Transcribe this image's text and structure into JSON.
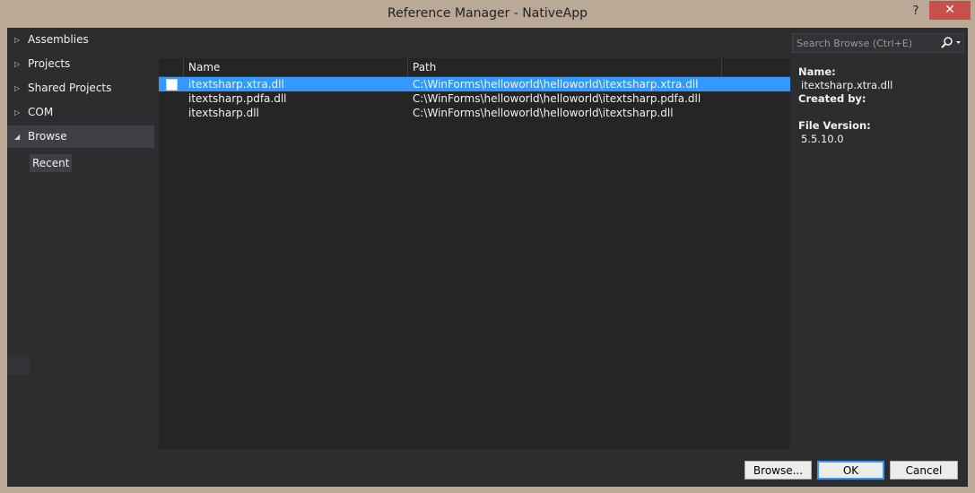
{
  "window": {
    "title": "Reference Manager - NativeApp",
    "help_glyph": "?",
    "close_glyph": "✕"
  },
  "nav": {
    "items": [
      {
        "label": "Assemblies",
        "expanded": false
      },
      {
        "label": "Projects",
        "expanded": false
      },
      {
        "label": "Shared Projects",
        "expanded": false
      },
      {
        "label": "COM",
        "expanded": false
      },
      {
        "label": "Browse",
        "expanded": true
      }
    ],
    "sub_item": "Recent"
  },
  "search": {
    "placeholder": "Search Browse (Ctrl+E)"
  },
  "list": {
    "columns": [
      "Name",
      "Path"
    ],
    "rows": [
      {
        "name": "itextsharp.xtra.dll",
        "path": "C:\\WinForms\\helloworld\\helloworld\\itextsharp.xtra.dll",
        "selected": true,
        "checked": false
      },
      {
        "name": "itextsharp.pdfa.dll",
        "path": "C:\\WinForms\\helloworld\\helloworld\\itextsharp.pdfa.dll",
        "selected": false,
        "checked": false
      },
      {
        "name": "itextsharp.dll",
        "path": "C:\\WinForms\\helloworld\\helloworld\\itextsharp.dll",
        "selected": false,
        "checked": false
      }
    ]
  },
  "details": {
    "name_label": "Name:",
    "name_value": "itextsharp.xtra.dll",
    "created_by_label": "Created by:",
    "created_by_value": "",
    "file_version_label": "File Version:",
    "file_version_value": "5.5.10.0"
  },
  "buttons": {
    "browse": "Browse...",
    "ok": "OK",
    "cancel": "Cancel"
  },
  "colors": {
    "selection": "#3399ff",
    "close_button": "#c7514a",
    "panel_bg": "#2d2d30",
    "list_bg": "#252526"
  }
}
